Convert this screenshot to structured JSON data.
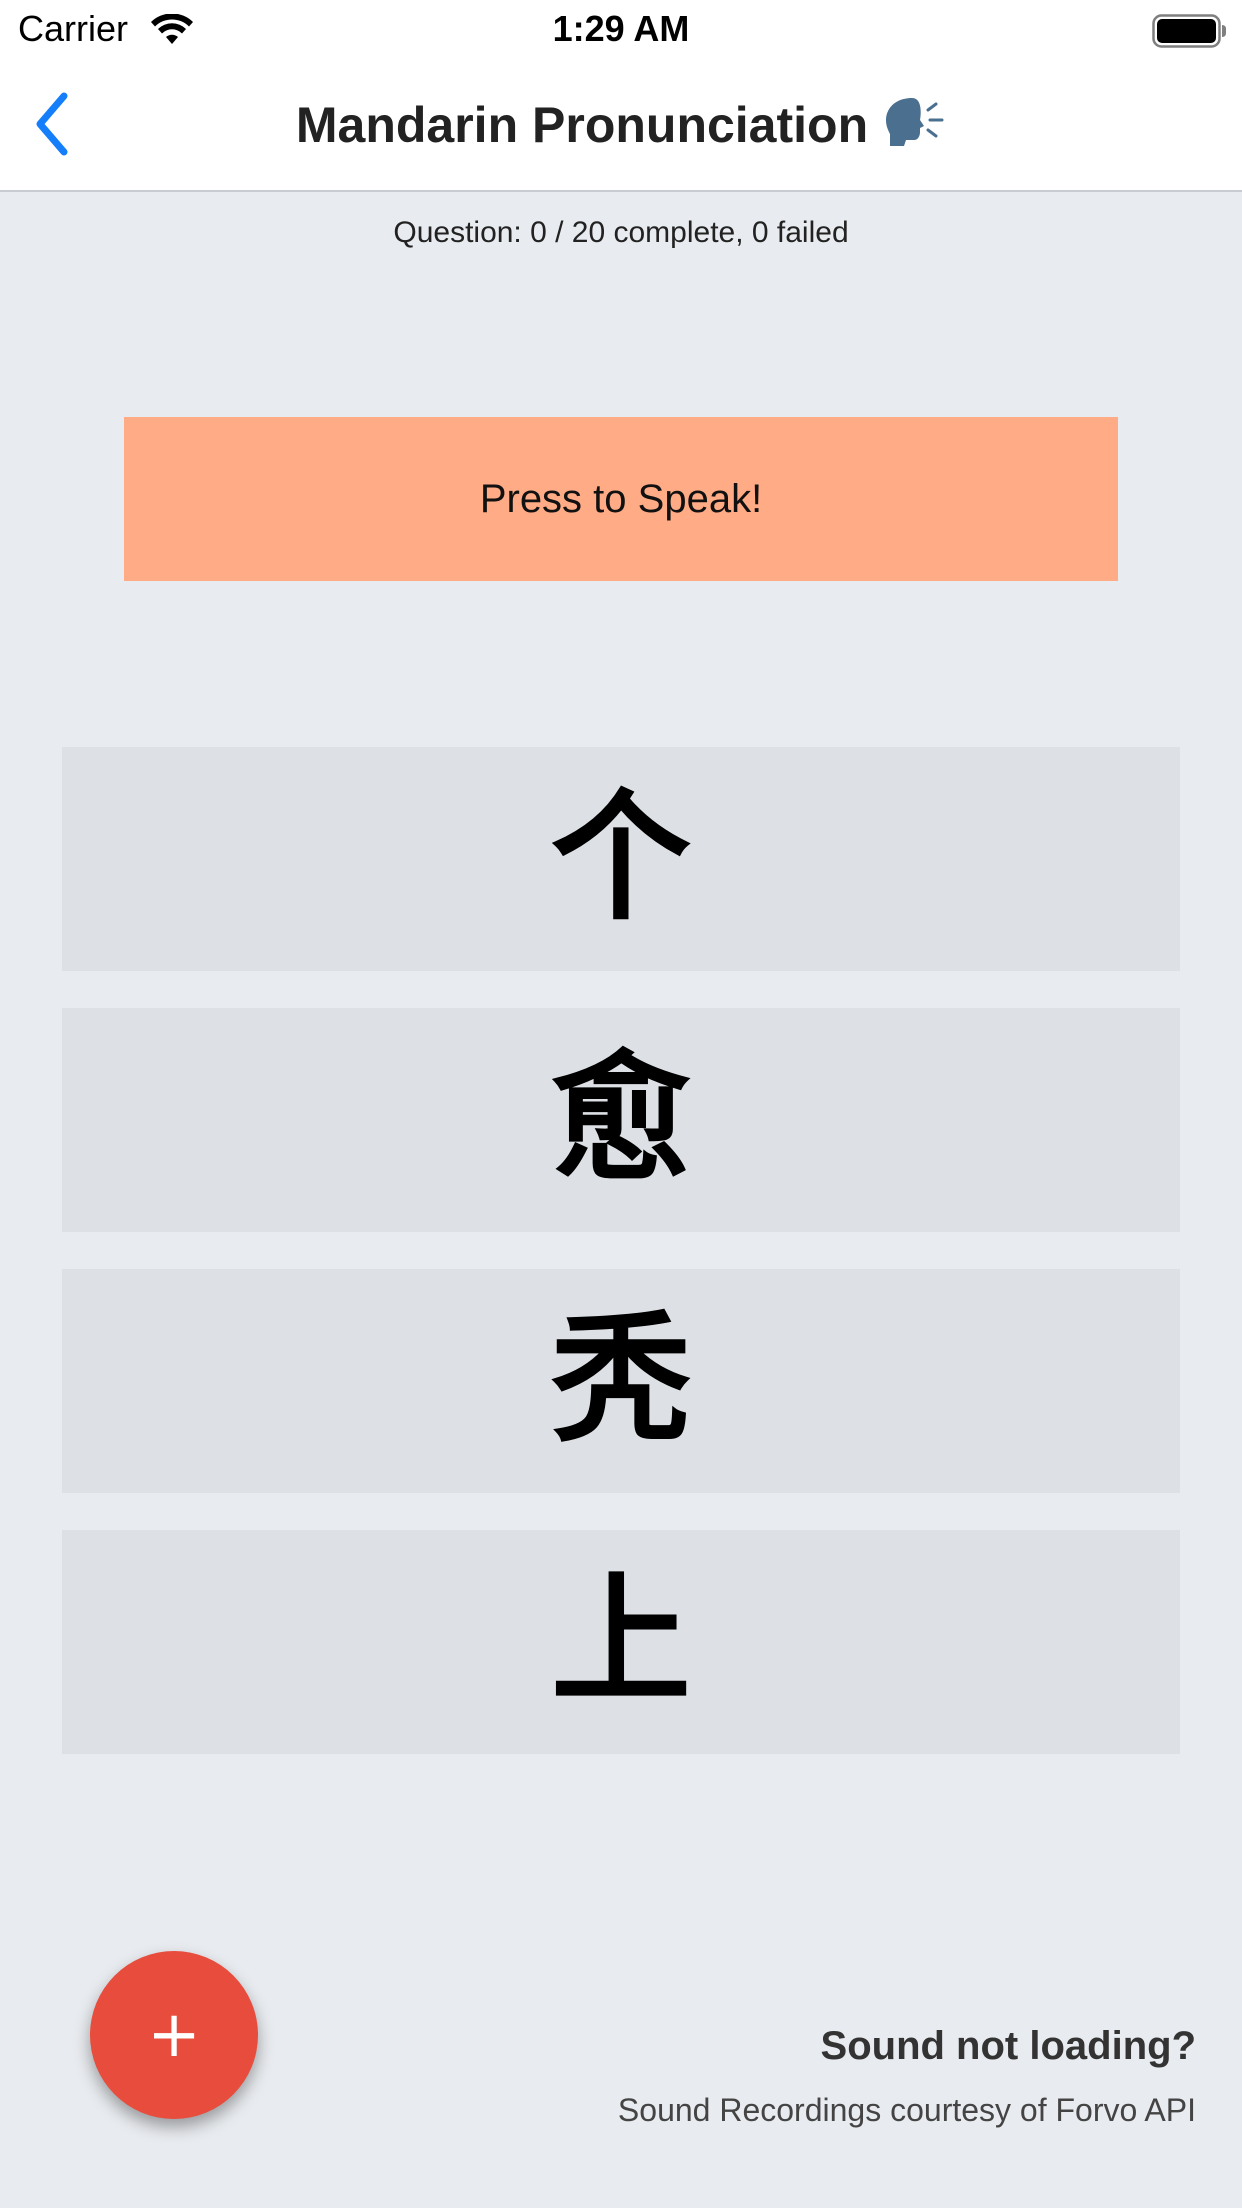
{
  "status_bar": {
    "carrier": "Carrier",
    "time": "1:29 AM"
  },
  "nav": {
    "title": "Mandarin Pronunciation",
    "title_icon": "speaking-head-icon",
    "back_icon": "chevron-left-icon",
    "accent_color": "#147efb"
  },
  "progress": {
    "text": "Question: 0 / 20 complete, 0 failed"
  },
  "speak_button": {
    "label": "Press to Speak!",
    "color": "#ffab85"
  },
  "choices": [
    {
      "character": "个"
    },
    {
      "character": "愈"
    },
    {
      "character": "秃"
    },
    {
      "character": "上"
    }
  ],
  "fab": {
    "label": "+",
    "color": "#e74c3c"
  },
  "footer": {
    "help_link": "Sound not loading?",
    "credits": "Sound Recordings courtesy of Forvo API"
  }
}
